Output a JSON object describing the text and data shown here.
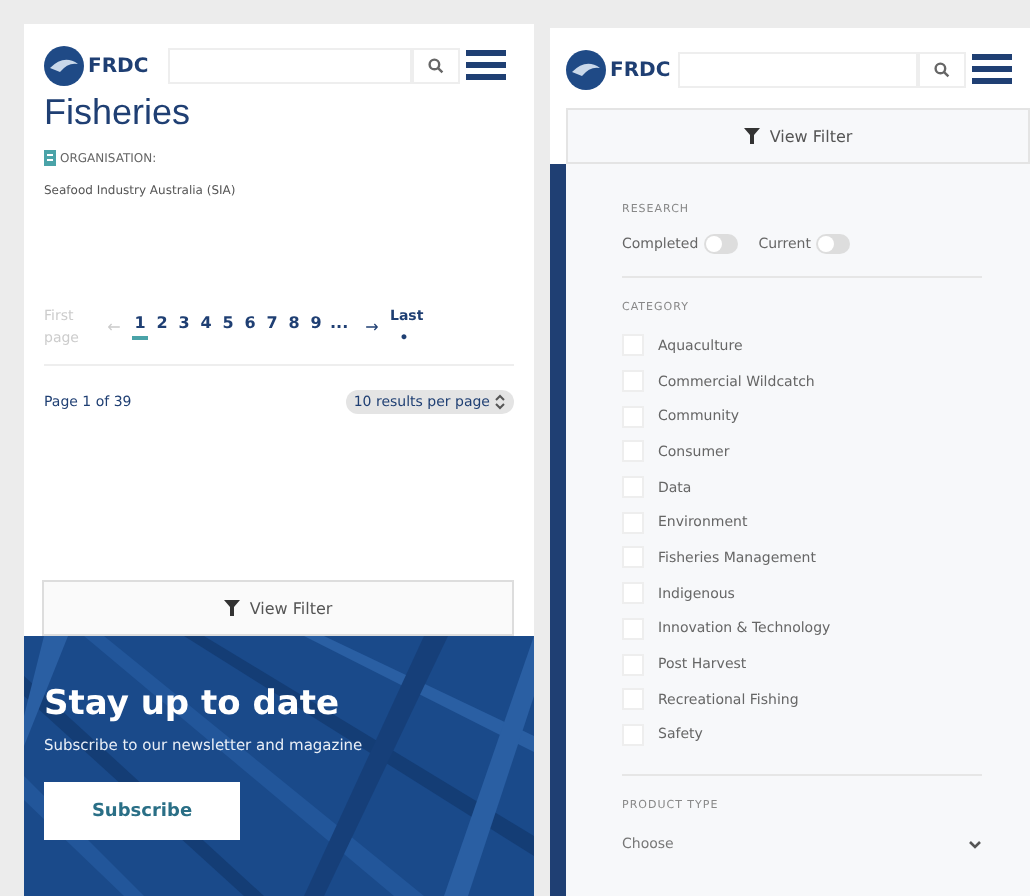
{
  "left_panel": {
    "header": {
      "logo_text": "FRDC"
    },
    "title": "Fisheries",
    "organisation": {
      "label": "ORGANISATION:",
      "value": "Seafood Industry Australia (SIA)"
    },
    "pagination": {
      "first": {
        "label": "First page",
        "disabled": true
      },
      "prev": {
        "label": "←",
        "disabled": true
      },
      "pages": [
        {
          "label": "1",
          "selected": true
        },
        {
          "label": "2",
          "selected": false
        },
        {
          "label": "3",
          "selected": false
        },
        {
          "label": "4",
          "selected": false
        },
        {
          "label": "5",
          "selected": false
        },
        {
          "label": "6",
          "selected": false
        },
        {
          "label": "7",
          "selected": false
        },
        {
          "label": "8",
          "selected": false
        },
        {
          "label": "9",
          "selected": false
        }
      ],
      "ellipsis": "...",
      "next": {
        "label": "→",
        "disabled": false
      },
      "last": {
        "label": "Last •",
        "disabled": false
      }
    },
    "page_info": "Page 1 of 39",
    "per_page": "10 results per page",
    "filter_button": "View Filter",
    "banner": {
      "title": "Stay up to date",
      "subtitle": "Subscribe to our newsletter and magazine",
      "button": "Subscribe"
    }
  },
  "right_panel": {
    "header": {
      "logo_text": "FRDC"
    },
    "filter_button": "View Filter",
    "research": {
      "heading": "RESEARCH",
      "toggles": [
        {
          "label": "Completed",
          "on": false
        },
        {
          "label": "Current",
          "on": false
        }
      ]
    },
    "category": {
      "heading": "CATEGORY",
      "items": [
        {
          "label": "Aquaculture",
          "checked": false
        },
        {
          "label": "Commercial Wildcatch",
          "checked": false
        },
        {
          "label": "Community",
          "checked": false
        },
        {
          "label": "Consumer",
          "checked": false
        },
        {
          "label": "Data",
          "checked": false
        },
        {
          "label": "Environment",
          "checked": false
        },
        {
          "label": "Fisheries Management",
          "checked": false
        },
        {
          "label": "Indigenous",
          "checked": false
        },
        {
          "label": "Innovation & Technology",
          "checked": false
        },
        {
          "label": "Post Harvest",
          "checked": false
        },
        {
          "label": "Recreational Fishing",
          "checked": false
        },
        {
          "label": "Safety",
          "checked": false
        }
      ]
    },
    "product_type": {
      "heading": "PRODUCT TYPE",
      "select": "Choose"
    }
  }
}
